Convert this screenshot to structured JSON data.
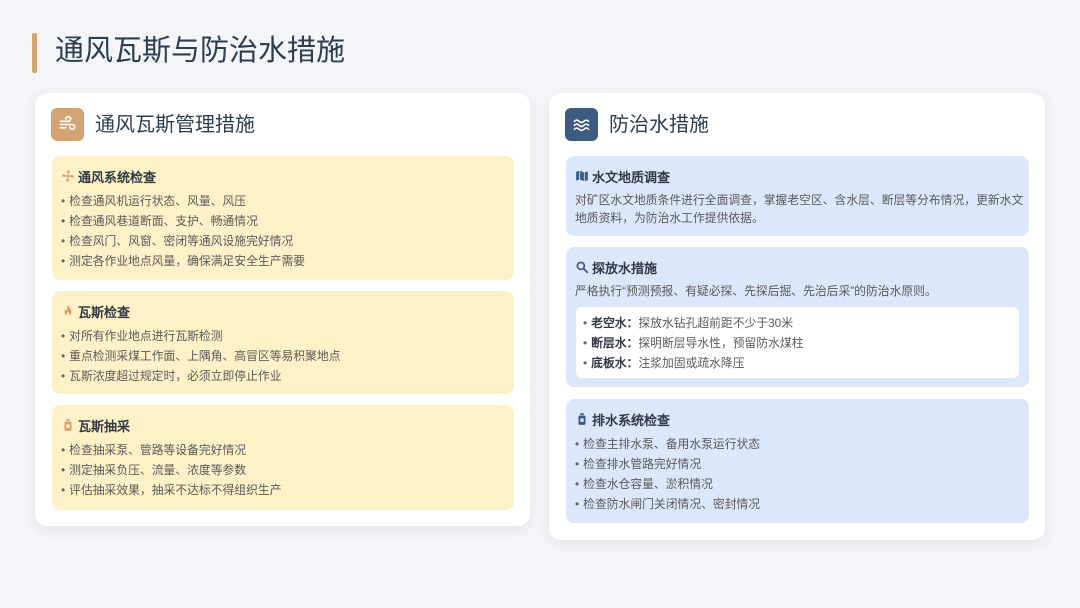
{
  "colors": {
    "accent": "#d4a373",
    "navy": "#3d5a80",
    "yellow_bg": "#fdf1c8",
    "blue_bg": "#dbe7fa",
    "title": "#2c3e50",
    "page_bg": "#f4f5f9"
  },
  "slide": {
    "title": "通风瓦斯与防治水措施"
  },
  "left_panel": {
    "icon": "wind-icon",
    "title": "通风瓦斯管理措施",
    "sections": [
      {
        "icon": "fan-icon",
        "title": "通风系统检查",
        "items": [
          "检查通风机运行状态、风量、风压",
          "检查通风巷道断面、支护、畅通情况",
          "检查风门、风窗、密闭等通风设施完好情况",
          "测定各作业地点风量，确保满足安全生产需要"
        ]
      },
      {
        "icon": "fire-icon",
        "title": "瓦斯检查",
        "items": [
          "对所有作业地点进行瓦斯检测",
          "重点检测采煤工作面、上隅角、高冒区等易积聚地点",
          "瓦斯浓度超过规定时，必须立即停止作业"
        ]
      },
      {
        "icon": "pump-icon",
        "title": "瓦斯抽采",
        "items": [
          "检查抽采泵、管路等设备完好情况",
          "测定抽采负压、流量、浓度等参数",
          "评估抽采效果，抽采不达标不得组织生产"
        ]
      }
    ]
  },
  "right_panel": {
    "icon": "water-waves-icon",
    "title": "防治水措施",
    "sections": [
      {
        "icon": "map-icon",
        "title": "水文地质调查",
        "text": "对矿区水文地质条件进行全面调查，掌握老空区、含水层、断层等分布情况，更新水文地质资料，为防治水工作提供依据。"
      },
      {
        "icon": "search-icon",
        "title": "探放水措施",
        "text": "严格执行“预测预报、有疑必探、先探后掘、先治后采”的防治水原则。",
        "details": [
          {
            "label": "老空水：",
            "text": "探放水钻孔超前距不少于30米"
          },
          {
            "label": "断层水：",
            "text": "探明断层导水性，预留防水煤柱"
          },
          {
            "label": "底板水：",
            "text": "注浆加固或疏水降压"
          }
        ]
      },
      {
        "icon": "pump-icon",
        "title": "排水系统检查",
        "items": [
          "检查主排水泵、备用水泵运行状态",
          "检查排水管路完好情况",
          "检查水仓容量、淤积情况",
          "检查防水闸门关闭情况、密封情况"
        ]
      }
    ]
  }
}
